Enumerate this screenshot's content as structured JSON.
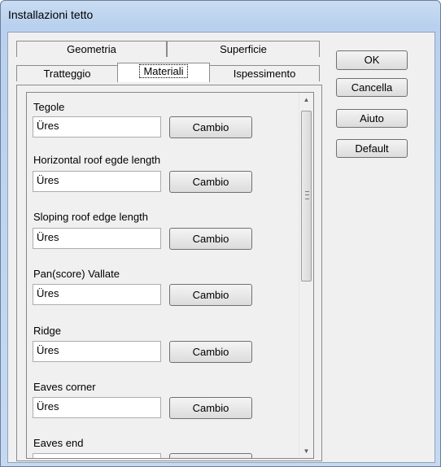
{
  "window": {
    "title": "Installazioni tetto"
  },
  "tabs": {
    "row1": [
      "Geometria",
      "Superficie"
    ],
    "row2": [
      "Tratteggio",
      "Materiali",
      "Ispessimento"
    ]
  },
  "materials": [
    {
      "label": "Tegole",
      "value": "Üres",
      "button": "Cambio"
    },
    {
      "label": "Horizontal roof egde length",
      "value": "Üres",
      "button": "Cambio"
    },
    {
      "label": "Sloping roof edge length",
      "value": "Üres",
      "button": "Cambio"
    },
    {
      "label": "Pan(score) Vallate",
      "value": "Üres",
      "button": "Cambio"
    },
    {
      "label": "Ridge",
      "value": "Üres",
      "button": "Cambio"
    },
    {
      "label": "Eaves corner",
      "value": "Üres",
      "button": "Cambio"
    },
    {
      "label": "Eaves end",
      "value": "",
      "button": ""
    }
  ],
  "buttons": {
    "ok": "OK",
    "cancel": "Cancella",
    "help": "Aiuto",
    "default": "Default"
  },
  "scrollbar": {
    "up": "▲",
    "down": "▼"
  }
}
